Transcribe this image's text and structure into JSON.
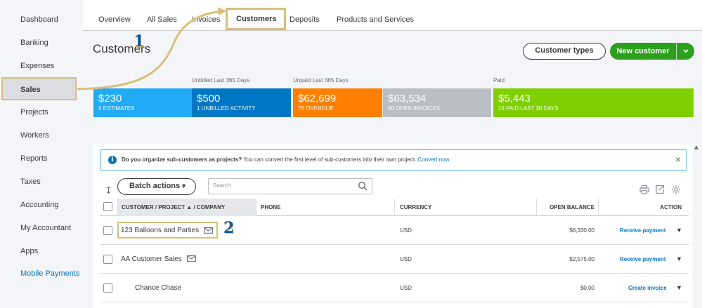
{
  "sidebar": {
    "items": [
      {
        "label": "Dashboard"
      },
      {
        "label": "Banking"
      },
      {
        "label": "Expenses"
      },
      {
        "label": "Sales"
      },
      {
        "label": "Projects"
      },
      {
        "label": "Workers"
      },
      {
        "label": "Reports"
      },
      {
        "label": "Taxes"
      },
      {
        "label": "Accounting"
      },
      {
        "label": "My Accountant"
      },
      {
        "label": "Apps"
      },
      {
        "label": "Mobile Payments"
      }
    ]
  },
  "tabs": [
    {
      "label": "Overview"
    },
    {
      "label": "All Sales"
    },
    {
      "label": "Invoices"
    },
    {
      "label": "Customers"
    },
    {
      "label": "Deposits"
    },
    {
      "label": "Products and Services"
    }
  ],
  "page_title": "Customers",
  "header_buttons": {
    "customer_types": "Customer types",
    "new_customer": "New customer",
    "new_customer_caret": "⌄"
  },
  "money_bar": {
    "labels": {
      "unbilled": "Unbilled Last 365 Days",
      "unpaid": "Unpaid Last 365 Days",
      "paid": "Paid"
    },
    "blocks": [
      {
        "amount": "$230",
        "sub": "5 ESTIMATES",
        "color": "#21abf6"
      },
      {
        "amount": "$500",
        "sub": "1 UNBILLED ACTIVITY",
        "color": "#0077c5"
      },
      {
        "amount": "$62,699",
        "sub": "76 OVERDUE",
        "color": "#ff8000"
      },
      {
        "amount": "$63,534",
        "sub": "80 OPEN INVOICES",
        "color": "#babec5"
      },
      {
        "amount": "$5,443",
        "sub": "15 PAID LAST 30 DAYS",
        "color": "#7fd000"
      }
    ]
  },
  "banner": {
    "bold": "Do you organize sub-customers as projects?",
    "text": " You can convert the first level of sub-customers into their own project. ",
    "link": "Convert now",
    "info_glyph": "i",
    "close_glyph": "×"
  },
  "toolbar": {
    "batch_label": "Batch actions",
    "batch_caret": "▼",
    "sort_glyph": "↧",
    "search_placeholder": "Search",
    "scroll_glyph": "▲"
  },
  "table": {
    "headers": {
      "customer": "CUSTOMER / PROJECT ▲ / COMPANY",
      "phone": "PHONE",
      "currency": "CURRENCY",
      "balance": "OPEN BALANCE",
      "action": "ACTION"
    },
    "rows": [
      {
        "name": "123 Balloons and Parties",
        "phone": "",
        "currency": "USD",
        "balance": "$6,330.00",
        "action": "Receive payment"
      },
      {
        "name": "AA Customer Sales",
        "phone": "",
        "currency": "USD",
        "balance": "$2,575.00",
        "action": "Receive payment"
      },
      {
        "name": "Chance Chase",
        "phone": "",
        "currency": "USD",
        "balance": "$0.00",
        "action": "Create invoice"
      }
    ],
    "caret": "▼"
  },
  "annotations": {
    "one": "1",
    "two": "2"
  },
  "icons": {
    "sort": "sort-icon",
    "search": "search-icon",
    "print": "print-icon",
    "export": "export-icon",
    "settings": "gear-icon",
    "mail": "mail-icon",
    "info": "info-icon",
    "close": "close-icon"
  },
  "colors": {
    "accent_green": "#2ca01c",
    "link_blue": "#0077c5",
    "annotation_gold": "#d9bf79",
    "annotation_blue": "#0b5aa8"
  }
}
